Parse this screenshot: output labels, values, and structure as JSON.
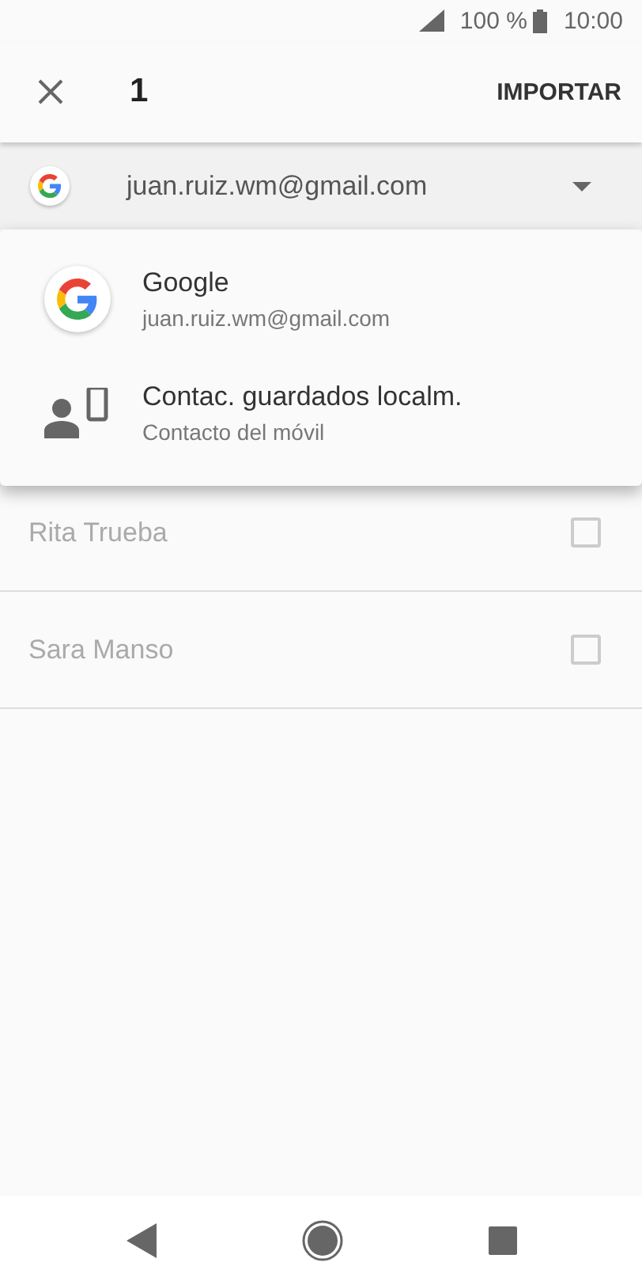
{
  "status_bar": {
    "battery": "100 %",
    "time": "10:00"
  },
  "toolbar": {
    "count": "1",
    "action": "IMPORTAR"
  },
  "account_selector": {
    "email": "juan.ruiz.wm@gmail.com"
  },
  "account_menu": [
    {
      "kind": "google",
      "title": "Google",
      "subtitle": "juan.ruiz.wm@gmail.com"
    },
    {
      "kind": "device",
      "title": "Contac. guardados localm.",
      "subtitle": "Contacto del móvil"
    }
  ],
  "contacts": [
    {
      "name": "Rita Trueba",
      "checked": false
    },
    {
      "name": "Sara Manso",
      "checked": false
    }
  ]
}
